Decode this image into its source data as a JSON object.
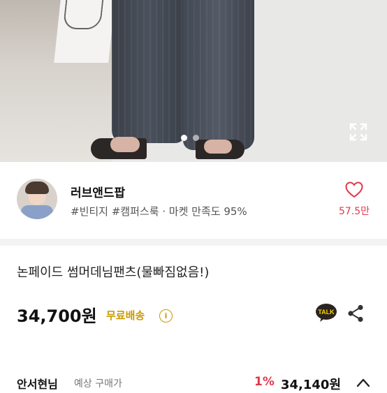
{
  "carousel": {
    "page_count": 2,
    "active_index": 0,
    "expand_icon": "expand-icon"
  },
  "seller": {
    "name": "러브앤드팝",
    "tags": "#빈티지 #캠퍼스룩 · 마켓 만족도 95%",
    "like_count": "57.5만",
    "heart_icon": "heart-outline-icon",
    "accent_color": "#e2394b"
  },
  "product": {
    "title": "논페이드 썸머데님팬츠(물빠짐없음!)",
    "price": "34,700원",
    "free_shipping_label": "무료배송",
    "info_icon_text": "i",
    "free_shipping_color": "#c99a00",
    "talk_icon": "kakao-talk-icon",
    "talk_label": "TALK",
    "share_icon": "share-icon"
  },
  "bottom_bar": {
    "name": "안서현님",
    "label": "예상 구매가",
    "discount": "1%",
    "price": "34,140원",
    "chevron_icon": "chevron-up-icon"
  }
}
